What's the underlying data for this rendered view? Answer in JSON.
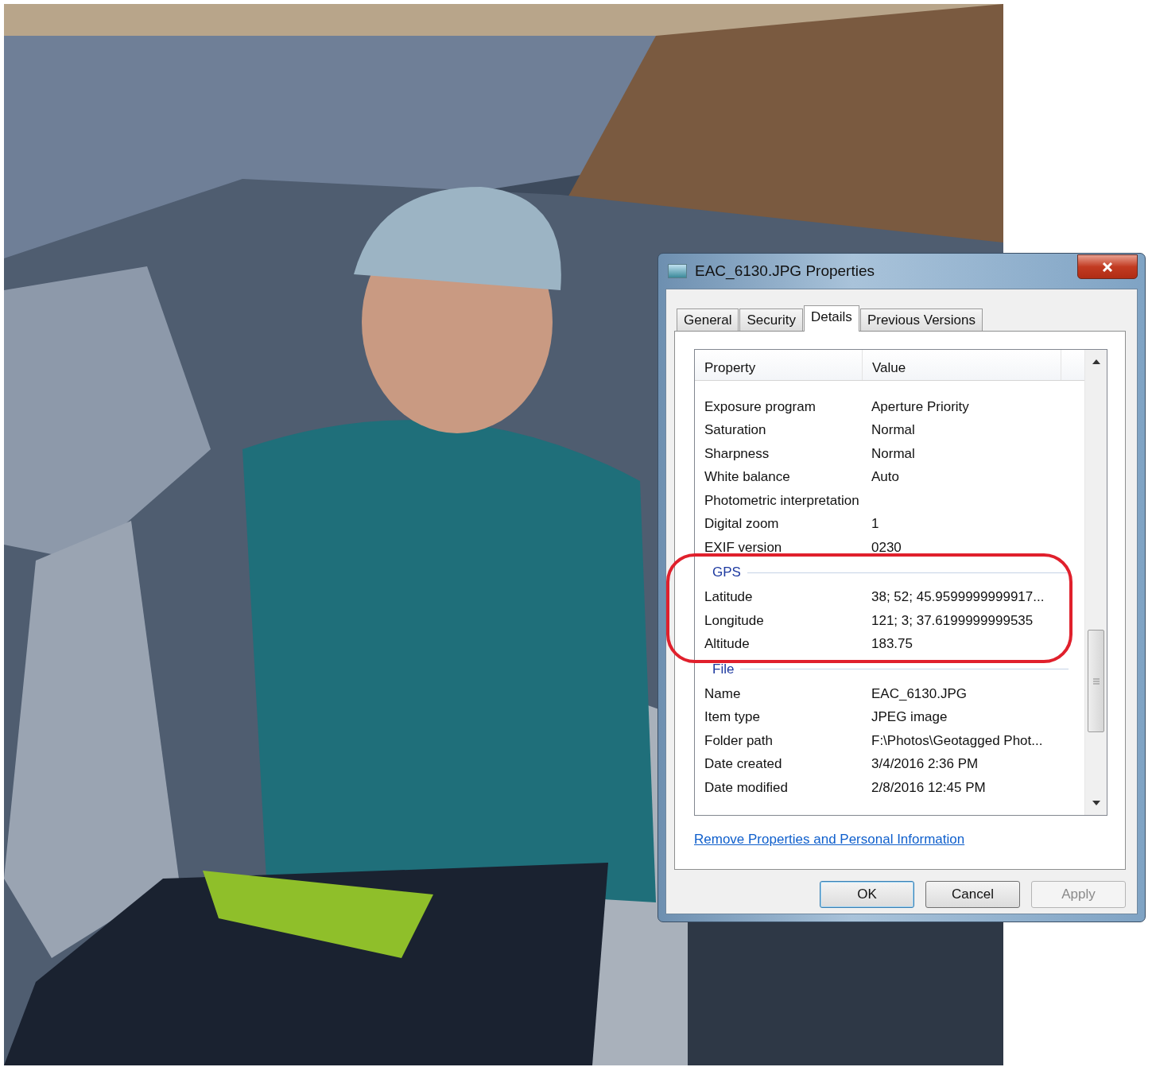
{
  "dialog": {
    "title": "EAC_6130.JPG Properties",
    "tabs": [
      {
        "label": "General",
        "selected": false
      },
      {
        "label": "Security",
        "selected": false
      },
      {
        "label": "Details",
        "selected": true
      },
      {
        "label": "Previous Versions",
        "selected": false
      }
    ],
    "columns": [
      "Property",
      "Value"
    ],
    "rows": [
      {
        "kind": "row",
        "property": "Exposure program",
        "value": "Aperture Priority"
      },
      {
        "kind": "row",
        "property": "Saturation",
        "value": "Normal"
      },
      {
        "kind": "row",
        "property": "Sharpness",
        "value": "Normal"
      },
      {
        "kind": "row",
        "property": "White balance",
        "value": "Auto"
      },
      {
        "kind": "row",
        "property": "Photometric interpretation"
      },
      {
        "kind": "row",
        "property": "Digital zoom",
        "value": "1"
      },
      {
        "kind": "row",
        "property": "EXIF version",
        "value": "0230"
      },
      {
        "kind": "group",
        "label": "GPS",
        "circled": true,
        "rows": [
          {
            "property": "Latitude",
            "value": "38; 52; 45.9599999999917..."
          },
          {
            "property": "Longitude",
            "value": "121; 3; 37.6199999999535"
          },
          {
            "property": "Altitude",
            "value": "183.75"
          }
        ]
      },
      {
        "kind": "group",
        "label": "File",
        "circled": false,
        "rows": [
          {
            "property": "Name",
            "value": "EAC_6130.JPG"
          },
          {
            "property": "Item type",
            "value": "JPEG image"
          },
          {
            "property": "Folder path",
            "value": "F:\\Photos\\Geotagged Phot..."
          },
          {
            "property": "Date created",
            "value": "3/4/2016 2:36 PM"
          },
          {
            "property": "Date modified",
            "value": "2/8/2016 12:45 PM"
          }
        ]
      }
    ],
    "link": "Remove Properties and Personal Information",
    "buttons": [
      {
        "label": "OK",
        "default": true,
        "disabled": false
      },
      {
        "label": "Cancel",
        "default": false,
        "disabled": false
      },
      {
        "label": "Apply",
        "default": false,
        "disabled": true
      }
    ]
  }
}
